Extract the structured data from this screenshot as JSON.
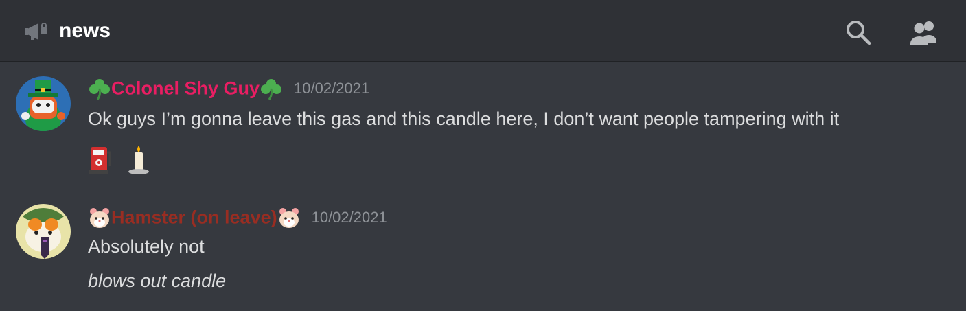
{
  "channel": {
    "name": "news",
    "icon": "announcement-megaphone-icon"
  },
  "header_actions": {
    "search_icon": "search-icon",
    "members_icon": "members-icon"
  },
  "messages": [
    {
      "username": "Colonel Shy Guy",
      "username_color": "#e91e63",
      "username_emoji": "shamrock",
      "timestamp": "10/02/2021",
      "text": "Ok guys I’m gonna leave this gas and this candle here, I don’t want people tampering with it",
      "emojis": [
        "fuel-pump",
        "candle"
      ]
    },
    {
      "username": "Hamster (on leave)",
      "username_color": "#992d22",
      "username_emoji": "hamster",
      "timestamp": "10/02/2021",
      "text": "Absolutely not",
      "text2": "blows out candle"
    }
  ],
  "colors": {
    "background": "#36393f",
    "header_background": "#2f3136",
    "text": "#dcddde",
    "timestamp": "#8e9297"
  }
}
